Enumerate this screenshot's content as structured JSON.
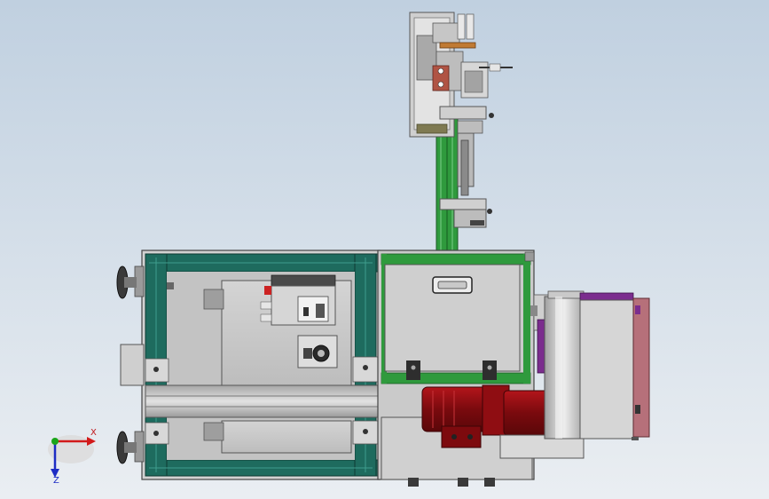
{
  "view": {
    "background_top": "#c0d0e0",
    "background_bottom": "#eaeef2",
    "colors": {
      "frame_profile": "#1e6b5e",
      "vertical_profile": "#2f9a3d",
      "sheet_metal": "#c9c9c9",
      "motor": "#8f0d12",
      "panel_accent": "#7b2d8e",
      "cover_plate": "#b6707a"
    }
  },
  "triad": {
    "x_label": "X",
    "z_label": "Z",
    "x_color": "#d21a1a",
    "y_color": "#1aa51a",
    "z_color": "#1d2cc4"
  }
}
